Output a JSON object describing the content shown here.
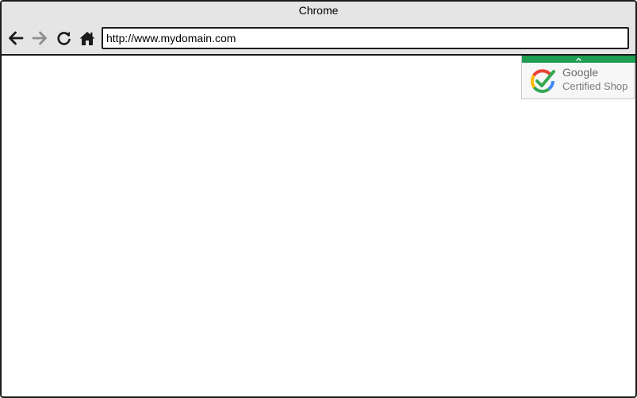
{
  "window": {
    "title": "Chrome"
  },
  "toolbar": {
    "back_icon": "back-arrow-icon",
    "forward_icon": "forward-arrow-icon",
    "reload_icon": "reload-icon",
    "home_icon": "home-icon",
    "address": "http://www.mydomain.com"
  },
  "badge": {
    "name": "Google",
    "subtitle": "Certified Shop",
    "collapse_icon": "chevron-up-icon",
    "logo_icon": "google-check-icon",
    "accent": "#1e9c4f"
  },
  "colors": {
    "chrome_bg": "#e5e5e5",
    "frame": "#1b1b1b",
    "forward_disabled": "#8e8e8e"
  }
}
